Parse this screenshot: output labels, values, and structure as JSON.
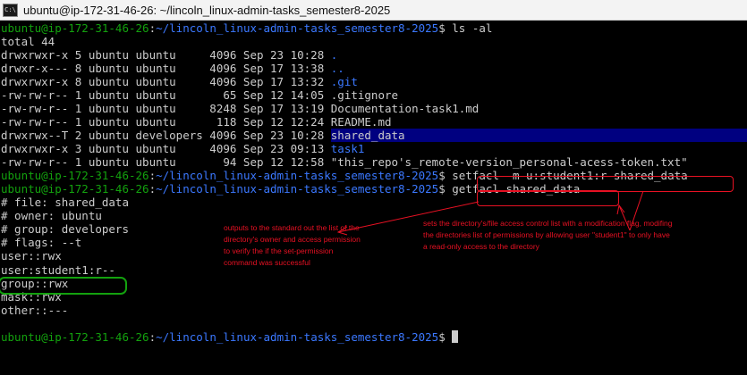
{
  "window": {
    "title": "ubuntu@ip-172-31-46-26: ~/lincoln_linux-admin-tasks_semester8-2025",
    "icon": "terminal-icon"
  },
  "prompt": {
    "user_host": "ubuntu@ip-172-31-46-26",
    "sep": ":",
    "path": "~/lincoln_linux-admin-tasks_semester8-2025",
    "symbol": "$ "
  },
  "commands": {
    "ls": "ls -al",
    "setfacl": "setfacl -m u:student1:r shared_data",
    "getfacl": "getfacl shared_data"
  },
  "ls_output": {
    "total": "total 44",
    "entries": [
      {
        "info": "drwxrwxr-x 5 ubuntu ubuntu     4096 Sep 23 10:28 ",
        "name": ".",
        "type": "dir"
      },
      {
        "info": "drwxr-x--- 8 ubuntu ubuntu     4096 Sep 17 13:38 ",
        "name": "..",
        "type": "dir"
      },
      {
        "info": "drwxrwxr-x 8 ubuntu ubuntu     4096 Sep 17 13:32 ",
        "name": ".git",
        "type": "dir"
      },
      {
        "info": "-rw-rw-r-- 1 ubuntu ubuntu       65 Sep 12 14:05 ",
        "name": ".gitignore",
        "type": "file"
      },
      {
        "info": "-rw-rw-r-- 1 ubuntu ubuntu     8248 Sep 17 13:19 ",
        "name": "Documentation-task1.md",
        "type": "file"
      },
      {
        "info": "-rw-rw-r-- 1 ubuntu ubuntu      118 Sep 12 12:24 ",
        "name": "README.md",
        "type": "file"
      },
      {
        "info": "drwxrwx--T 2 ubuntu developers 4096 Sep 23 10:28 ",
        "name": "shared_data",
        "type": "sticky"
      },
      {
        "info": "drwxrwxr-x 3 ubuntu ubuntu     4096 Sep 23 09:13 ",
        "name": "task1",
        "type": "dir"
      },
      {
        "info": "-rw-rw-r-- 1 ubuntu ubuntu       94 Sep 12 12:58 ",
        "name": "\"this_repo's_remote-version_personal-acess-token.txt\"",
        "type": "file"
      }
    ]
  },
  "getfacl_output": [
    "# file: shared_data",
    "# owner: ubuntu",
    "# group: developers",
    "# flags: --t",
    "user::rwx",
    "user:student1:r--",
    "group::rwx",
    "mask::rwx",
    "other::---"
  ],
  "annotations": {
    "getfacl_note": [
      "outputs to the standard out the list of the",
      "directory's owner and access permission",
      "to verify the if the set-permission",
      "command was successful"
    ],
    "setfacl_note": [
      "sets the directory's/file access control list with a modification flag, modifing",
      "the directories list of permissions by allowing user \"student1\" to only have",
      "a read-only access to the directory"
    ]
  },
  "colors": {
    "prompt_user": "#13a10e",
    "prompt_path": "#3b78ff",
    "annotation": "#e81123",
    "highlight_bg": "#000080"
  }
}
